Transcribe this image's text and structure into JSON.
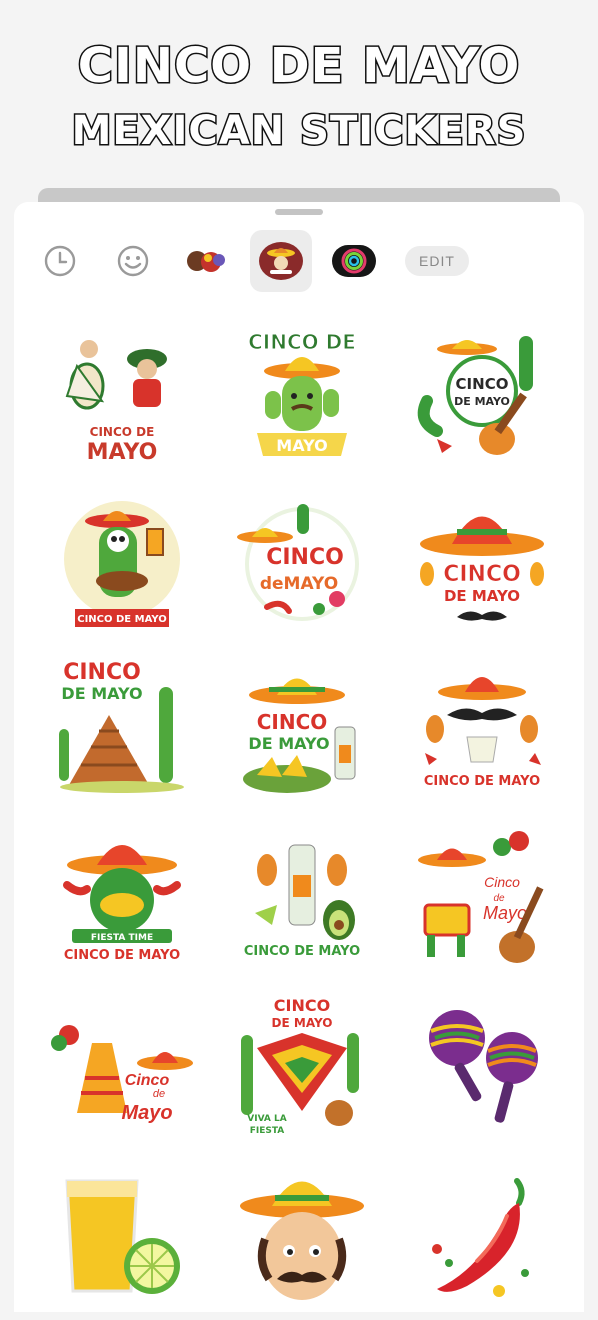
{
  "header": {
    "line1": "CINCO DE MAYO",
    "line2": "MEXICAN STICKERS"
  },
  "toolbar": {
    "items": [
      {
        "icon": "recent-clock-icon"
      },
      {
        "icon": "emoji-smiley-icon"
      },
      {
        "icon": "sticker-pack-faces-icon"
      },
      {
        "icon": "sticker-pack-cinco-de-mayo-icon",
        "selected": true
      },
      {
        "icon": "sticker-pack-ring-icon"
      }
    ],
    "edit_label": "EDIT"
  },
  "stickers": [
    {
      "name": "dancing-couple",
      "text": [
        "CINCO DE",
        "MAYO"
      ]
    },
    {
      "name": "cactus-sombrero",
      "text": [
        "CINCO DE",
        "MAYO"
      ]
    },
    {
      "name": "guitar-cactus-badge",
      "text": [
        "CINCO",
        "DE MAYO"
      ]
    },
    {
      "name": "skeleton-cactus-guitar",
      "text": [
        "CINCO DE MAYO"
      ]
    },
    {
      "name": "floral-wreath",
      "text": [
        "CINCO",
        "deMAYO"
      ]
    },
    {
      "name": "sombrero-mustache",
      "text": [
        "CINCO",
        "DE MAYO"
      ]
    },
    {
      "name": "pyramid-cactus",
      "text": [
        "CINCO",
        "DE MAYO"
      ]
    },
    {
      "name": "nachos-tequila",
      "text": [
        "CINCO",
        "DE MAYO"
      ]
    },
    {
      "name": "maracas-tequila",
      "text": [
        "CINCO DE MAYO"
      ]
    },
    {
      "name": "fiesta-time",
      "text": [
        "FIESTA TIME",
        "CINCO DE MAYO"
      ]
    },
    {
      "name": "tequila-avocado",
      "text": [
        "CINCO DE MAYO"
      ]
    },
    {
      "name": "pinata-guitar",
      "text": [
        "Cinco",
        "de",
        "Mayo"
      ]
    },
    {
      "name": "dress-hat",
      "text": [
        "Cinco",
        "de",
        "Mayo"
      ]
    },
    {
      "name": "poncho-guitar",
      "text": [
        "CINCO",
        "DE MAYO",
        "VIVA LA",
        "FIESTA"
      ]
    },
    {
      "name": "maracas",
      "text": []
    },
    {
      "name": "juice-lime",
      "text": []
    },
    {
      "name": "mustache-man",
      "text": []
    },
    {
      "name": "chili-pepper",
      "text": []
    }
  ],
  "colors": {
    "red": "#d8332b",
    "green": "#3a9b3a",
    "yellow": "#f5c623",
    "orange": "#f08a1c",
    "brown": "#8a4a1e"
  }
}
